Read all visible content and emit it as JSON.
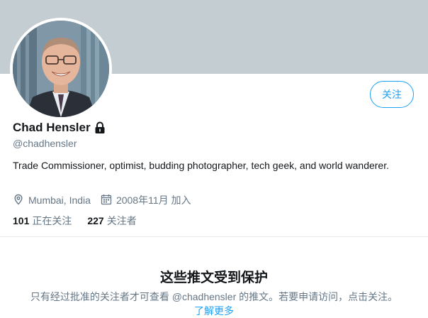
{
  "profile": {
    "display_name": "Chad Hensler",
    "handle": "@chadhensler",
    "bio": "Trade Commissioner, optimist, budding photographer, tech geek, and world wanderer.",
    "location": "Mumbai, India",
    "joined": "2008年11月 加入",
    "protected": true
  },
  "actions": {
    "follow_label": "关注"
  },
  "stats": {
    "following_count": "101",
    "following_label": "正在关注",
    "followers_count": "227",
    "followers_label": "关注者"
  },
  "protected_notice": {
    "title": "这些推文受到保护",
    "description": "只有经过批准的关注者才可查看 @chadhensler 的推文。若要申请访问，点击关注。",
    "learn_more": "了解更多"
  },
  "colors": {
    "accent": "#1da1f2",
    "banner": "#c4cdd2",
    "secondary_text": "#657786",
    "primary_text": "#14171a"
  },
  "icons": [
    "lock-icon",
    "location-icon",
    "calendar-icon"
  ]
}
